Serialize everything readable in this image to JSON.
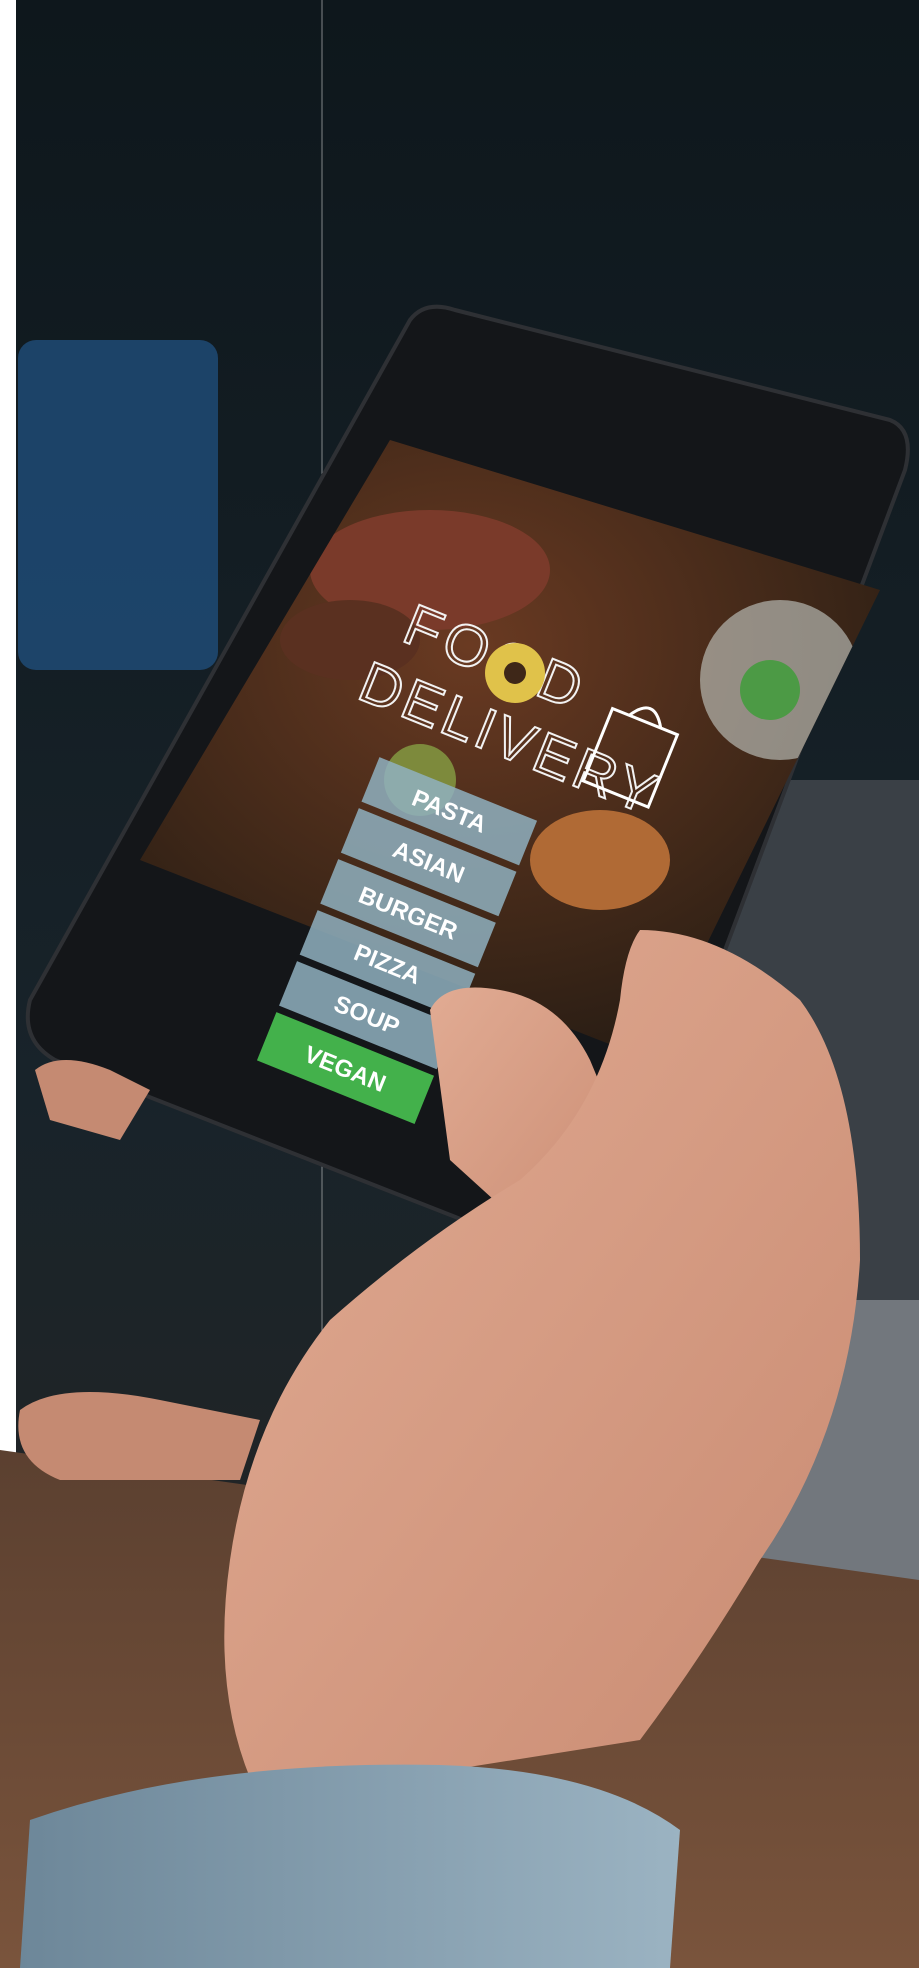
{
  "app": {
    "title_line1": "FOOD",
    "title_line2": "DELIVERY"
  },
  "menu": {
    "items": [
      {
        "label": "PASTA"
      },
      {
        "label": "ASIAN"
      },
      {
        "label": "BURGER"
      },
      {
        "label": "PIZZA"
      },
      {
        "label": "SOUP"
      },
      {
        "label": "VEGAN",
        "highlight": true
      }
    ]
  },
  "colors": {
    "accent": "#43b14b",
    "menu_button": "#8fb0bf",
    "phone_body": "#16181c",
    "desk_wood": "#6b4a36",
    "sleeve": "#7f9aad",
    "skin": "#d8a08a"
  },
  "icons": [
    "shopping-bag-icon",
    "donut-icon"
  ]
}
